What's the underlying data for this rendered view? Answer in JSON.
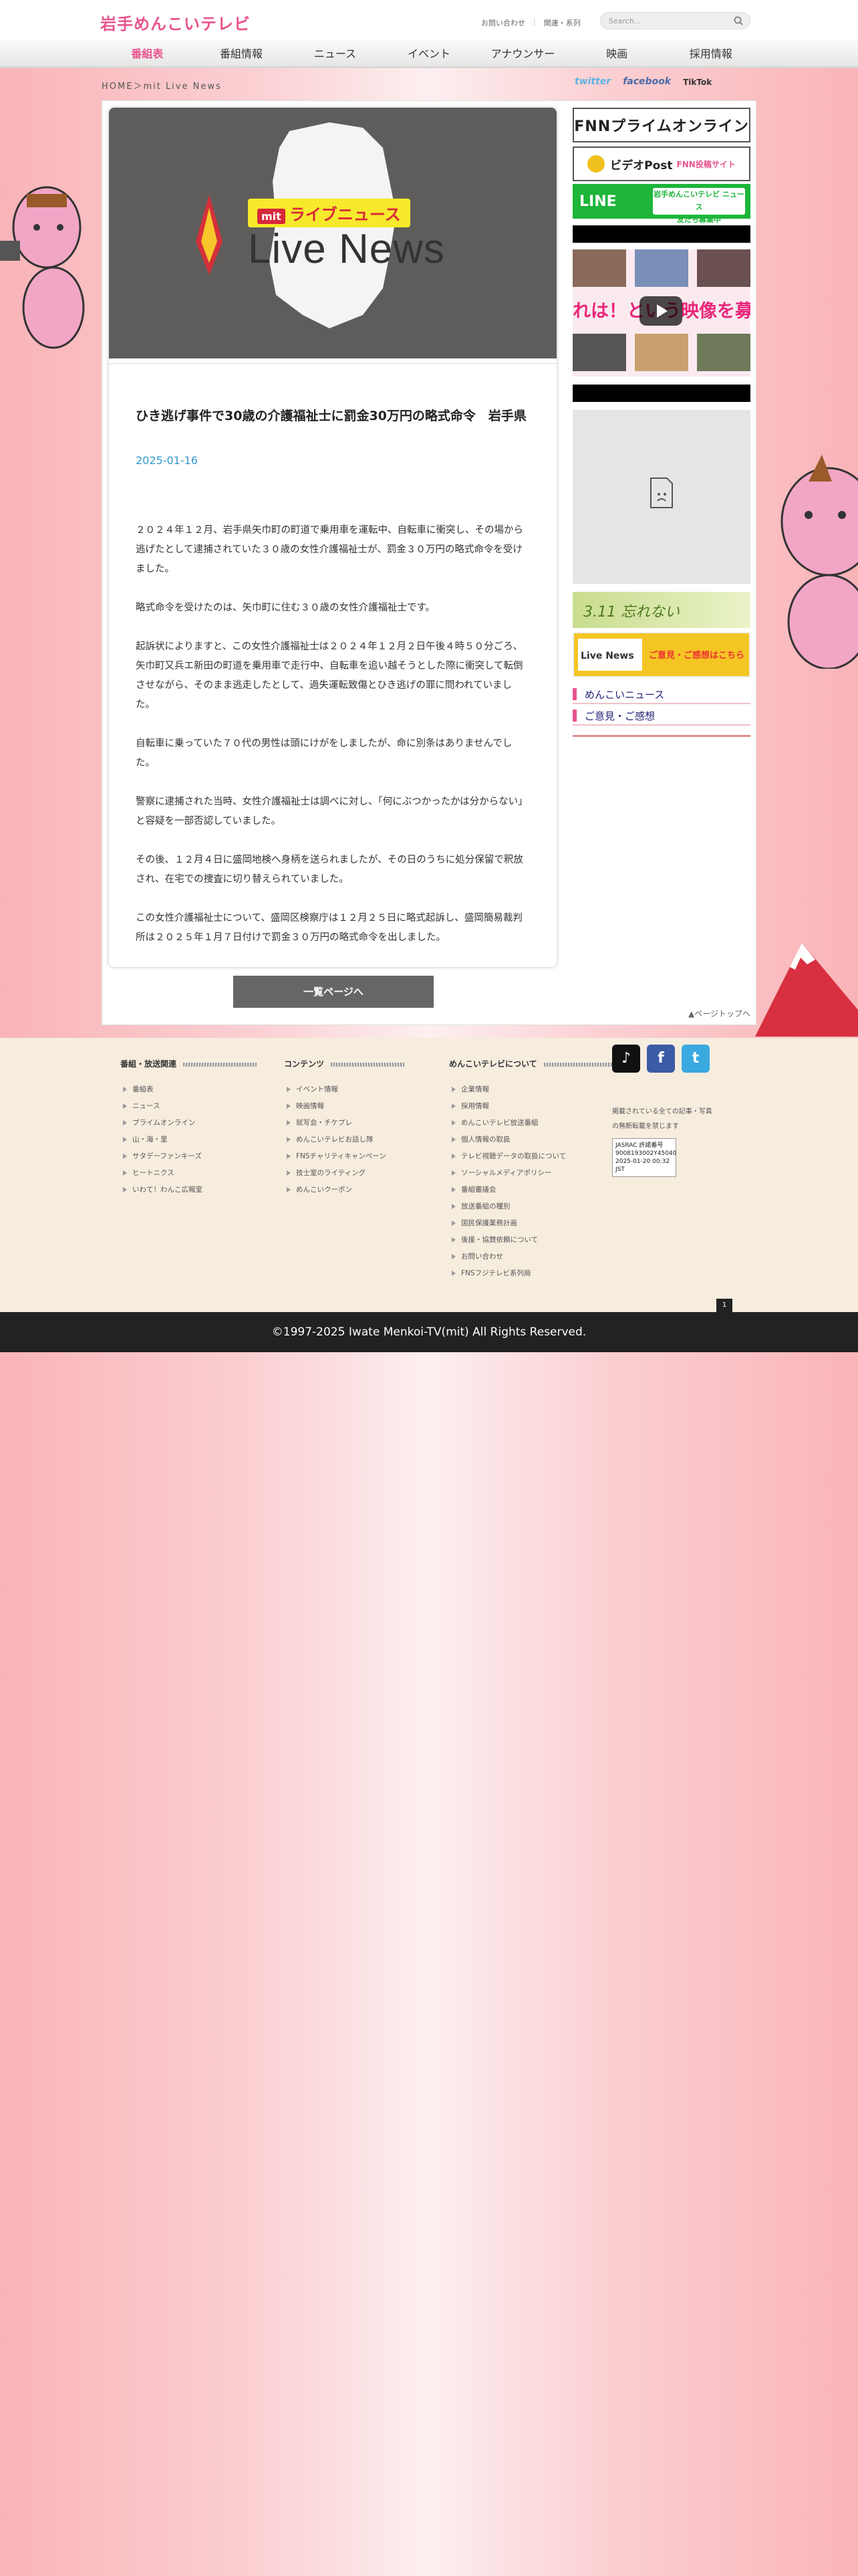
{
  "header": {
    "logo": "岩手めんこいテレビ",
    "links": [
      "お問い合わせ",
      "関連・系列"
    ],
    "search_placeholder": "Search..."
  },
  "nav": [
    "番組表",
    "番組情報",
    "ニュース",
    "イベント",
    "アナウンサー",
    "映画",
    "採用情報"
  ],
  "breadcrumb": "HOME＞mit Live News",
  "social_top": {
    "twitter": "twitter",
    "facebook": "facebook",
    "tiktok": "TikTok"
  },
  "hero": {
    "badge_mit": "mit",
    "badge_text": "ライブニュース",
    "title": "Live News"
  },
  "article": {
    "title": "ひき逃げ事件で30歳の介護福祉士に罰金30万円の略式命令　岩手県",
    "date": "2025-01-16",
    "paragraphs": [
      "２０２４年１２月、岩手県矢巾町の町道で乗用車を運転中、自転車に衝突し、その場から逃げたとして逮捕されていた３０歳の女性介護福祉士が、罰金３０万円の略式命令を受けました。",
      "略式命令を受けたのは、矢巾町に住む３０歳の女性介護福祉士です。",
      "起訴状によりますと、この女性介護福祉士は２０２４年１２月２日午後４時５０分ごろ、矢巾町又兵エ新田の町道を乗用車で走行中、自転車を追い越そうとした際に衝突して転倒させながら、そのまま逃走したとして、過失運転致傷とひき逃げの罪に問われていました。",
      "自転車に乗っていた７０代の男性は頭にけがをしましたが、命に別条はありませんでした。",
      "警察に逮捕された当時、女性介護福祉士は調べに対し、「何にぶつかったかは分からない」と容疑を一部否認していました。",
      "その後、１２月４日に盛岡地検へ身柄を送られましたが、その日のうちに処分保留で釈放され、在宅での捜査に切り替えられていました。",
      "この女性介護福祉士について、盛岡区検察庁は１２月２５日に略式起訴し、盛岡簡易裁判所は２０２５年１月７日付けで罰金３０万円の略式命令を出しました。"
    ]
  },
  "list_button": "一覧ページへ",
  "pagetop": "▲ページトップへ",
  "sidebar": {
    "fnn": "FNNプライムオンライン",
    "videopost": "ビデオPost",
    "videopost_sub": "FNN投稿サイト",
    "line": "LINE",
    "line_sub1": "友だち募集中",
    "line_sub2": "岩手めんこいテレビ ニュース",
    "video_banner": "れは！という映像を募集中",
    "b311": "3.11 忘れない",
    "live_label": "Live News",
    "live_link": "ご意見・ご感想はこちら",
    "links": [
      "めんこいニュース",
      "ご意見・ご感想"
    ]
  },
  "footer": {
    "columns": [
      {
        "head": "番組・放送関連",
        "items": [
          "番組表",
          "ニュース",
          "プライムオンライン",
          "山・海・里",
          "サタデーファンキーズ",
          "ヒートニクス",
          "いわて！わんこ広報室"
        ]
      },
      {
        "head": "コンテンツ",
        "items": [
          "イベント情報",
          "映画情報",
          "就写会・チケプレ",
          "めんこいテレビお話し隊",
          "FNSチャリティキャンペーン",
          "技士室のライティング",
          "めんこいクーポン"
        ]
      },
      {
        "head": "めんこいテレビについて",
        "items": [
          "企業情報",
          "採用情報",
          "めんこいテレビ放送番組",
          "個人情報の取扱",
          "テレビ視聴データの取扱について",
          "ソーシャルメディアポリシー",
          "番組審議会",
          "放送番組の種別",
          "国民保護業務計画",
          "後援・協賛依頼について",
          "お問い合わせ",
          "FNSフジテレビ系列局"
        ]
      }
    ],
    "note": "掲載されている全ての記事・写真の無断転載を禁じます",
    "badge_text": "JASRAC 許諾番号 9008193002Y45040 2025-01-20 00:32 JST",
    "page_no": "1"
  },
  "copyright": "©1997-2025 Iwate Menkoi-TV(mit) All Rights Reserved."
}
